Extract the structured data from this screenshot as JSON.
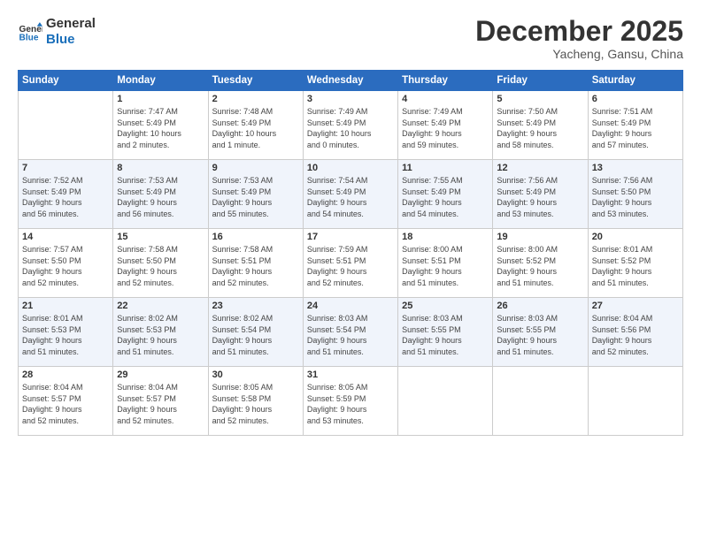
{
  "header": {
    "logo_line1": "General",
    "logo_line2": "Blue",
    "month": "December 2025",
    "location": "Yacheng, Gansu, China"
  },
  "weekdays": [
    "Sunday",
    "Monday",
    "Tuesday",
    "Wednesday",
    "Thursday",
    "Friday",
    "Saturday"
  ],
  "weeks": [
    [
      {
        "day": "",
        "info": ""
      },
      {
        "day": "1",
        "info": "Sunrise: 7:47 AM\nSunset: 5:49 PM\nDaylight: 10 hours\nand 2 minutes."
      },
      {
        "day": "2",
        "info": "Sunrise: 7:48 AM\nSunset: 5:49 PM\nDaylight: 10 hours\nand 1 minute."
      },
      {
        "day": "3",
        "info": "Sunrise: 7:49 AM\nSunset: 5:49 PM\nDaylight: 10 hours\nand 0 minutes."
      },
      {
        "day": "4",
        "info": "Sunrise: 7:49 AM\nSunset: 5:49 PM\nDaylight: 9 hours\nand 59 minutes."
      },
      {
        "day": "5",
        "info": "Sunrise: 7:50 AM\nSunset: 5:49 PM\nDaylight: 9 hours\nand 58 minutes."
      },
      {
        "day": "6",
        "info": "Sunrise: 7:51 AM\nSunset: 5:49 PM\nDaylight: 9 hours\nand 57 minutes."
      }
    ],
    [
      {
        "day": "7",
        "info": "Sunrise: 7:52 AM\nSunset: 5:49 PM\nDaylight: 9 hours\nand 56 minutes."
      },
      {
        "day": "8",
        "info": "Sunrise: 7:53 AM\nSunset: 5:49 PM\nDaylight: 9 hours\nand 56 minutes."
      },
      {
        "day": "9",
        "info": "Sunrise: 7:53 AM\nSunset: 5:49 PM\nDaylight: 9 hours\nand 55 minutes."
      },
      {
        "day": "10",
        "info": "Sunrise: 7:54 AM\nSunset: 5:49 PM\nDaylight: 9 hours\nand 54 minutes."
      },
      {
        "day": "11",
        "info": "Sunrise: 7:55 AM\nSunset: 5:49 PM\nDaylight: 9 hours\nand 54 minutes."
      },
      {
        "day": "12",
        "info": "Sunrise: 7:56 AM\nSunset: 5:49 PM\nDaylight: 9 hours\nand 53 minutes."
      },
      {
        "day": "13",
        "info": "Sunrise: 7:56 AM\nSunset: 5:50 PM\nDaylight: 9 hours\nand 53 minutes."
      }
    ],
    [
      {
        "day": "14",
        "info": "Sunrise: 7:57 AM\nSunset: 5:50 PM\nDaylight: 9 hours\nand 52 minutes."
      },
      {
        "day": "15",
        "info": "Sunrise: 7:58 AM\nSunset: 5:50 PM\nDaylight: 9 hours\nand 52 minutes."
      },
      {
        "day": "16",
        "info": "Sunrise: 7:58 AM\nSunset: 5:51 PM\nDaylight: 9 hours\nand 52 minutes."
      },
      {
        "day": "17",
        "info": "Sunrise: 7:59 AM\nSunset: 5:51 PM\nDaylight: 9 hours\nand 52 minutes."
      },
      {
        "day": "18",
        "info": "Sunrise: 8:00 AM\nSunset: 5:51 PM\nDaylight: 9 hours\nand 51 minutes."
      },
      {
        "day": "19",
        "info": "Sunrise: 8:00 AM\nSunset: 5:52 PM\nDaylight: 9 hours\nand 51 minutes."
      },
      {
        "day": "20",
        "info": "Sunrise: 8:01 AM\nSunset: 5:52 PM\nDaylight: 9 hours\nand 51 minutes."
      }
    ],
    [
      {
        "day": "21",
        "info": "Sunrise: 8:01 AM\nSunset: 5:53 PM\nDaylight: 9 hours\nand 51 minutes."
      },
      {
        "day": "22",
        "info": "Sunrise: 8:02 AM\nSunset: 5:53 PM\nDaylight: 9 hours\nand 51 minutes."
      },
      {
        "day": "23",
        "info": "Sunrise: 8:02 AM\nSunset: 5:54 PM\nDaylight: 9 hours\nand 51 minutes."
      },
      {
        "day": "24",
        "info": "Sunrise: 8:03 AM\nSunset: 5:54 PM\nDaylight: 9 hours\nand 51 minutes."
      },
      {
        "day": "25",
        "info": "Sunrise: 8:03 AM\nSunset: 5:55 PM\nDaylight: 9 hours\nand 51 minutes."
      },
      {
        "day": "26",
        "info": "Sunrise: 8:03 AM\nSunset: 5:55 PM\nDaylight: 9 hours\nand 51 minutes."
      },
      {
        "day": "27",
        "info": "Sunrise: 8:04 AM\nSunset: 5:56 PM\nDaylight: 9 hours\nand 52 minutes."
      }
    ],
    [
      {
        "day": "28",
        "info": "Sunrise: 8:04 AM\nSunset: 5:57 PM\nDaylight: 9 hours\nand 52 minutes."
      },
      {
        "day": "29",
        "info": "Sunrise: 8:04 AM\nSunset: 5:57 PM\nDaylight: 9 hours\nand 52 minutes."
      },
      {
        "day": "30",
        "info": "Sunrise: 8:05 AM\nSunset: 5:58 PM\nDaylight: 9 hours\nand 52 minutes."
      },
      {
        "day": "31",
        "info": "Sunrise: 8:05 AM\nSunset: 5:59 PM\nDaylight: 9 hours\nand 53 minutes."
      },
      {
        "day": "",
        "info": ""
      },
      {
        "day": "",
        "info": ""
      },
      {
        "day": "",
        "info": ""
      }
    ]
  ]
}
